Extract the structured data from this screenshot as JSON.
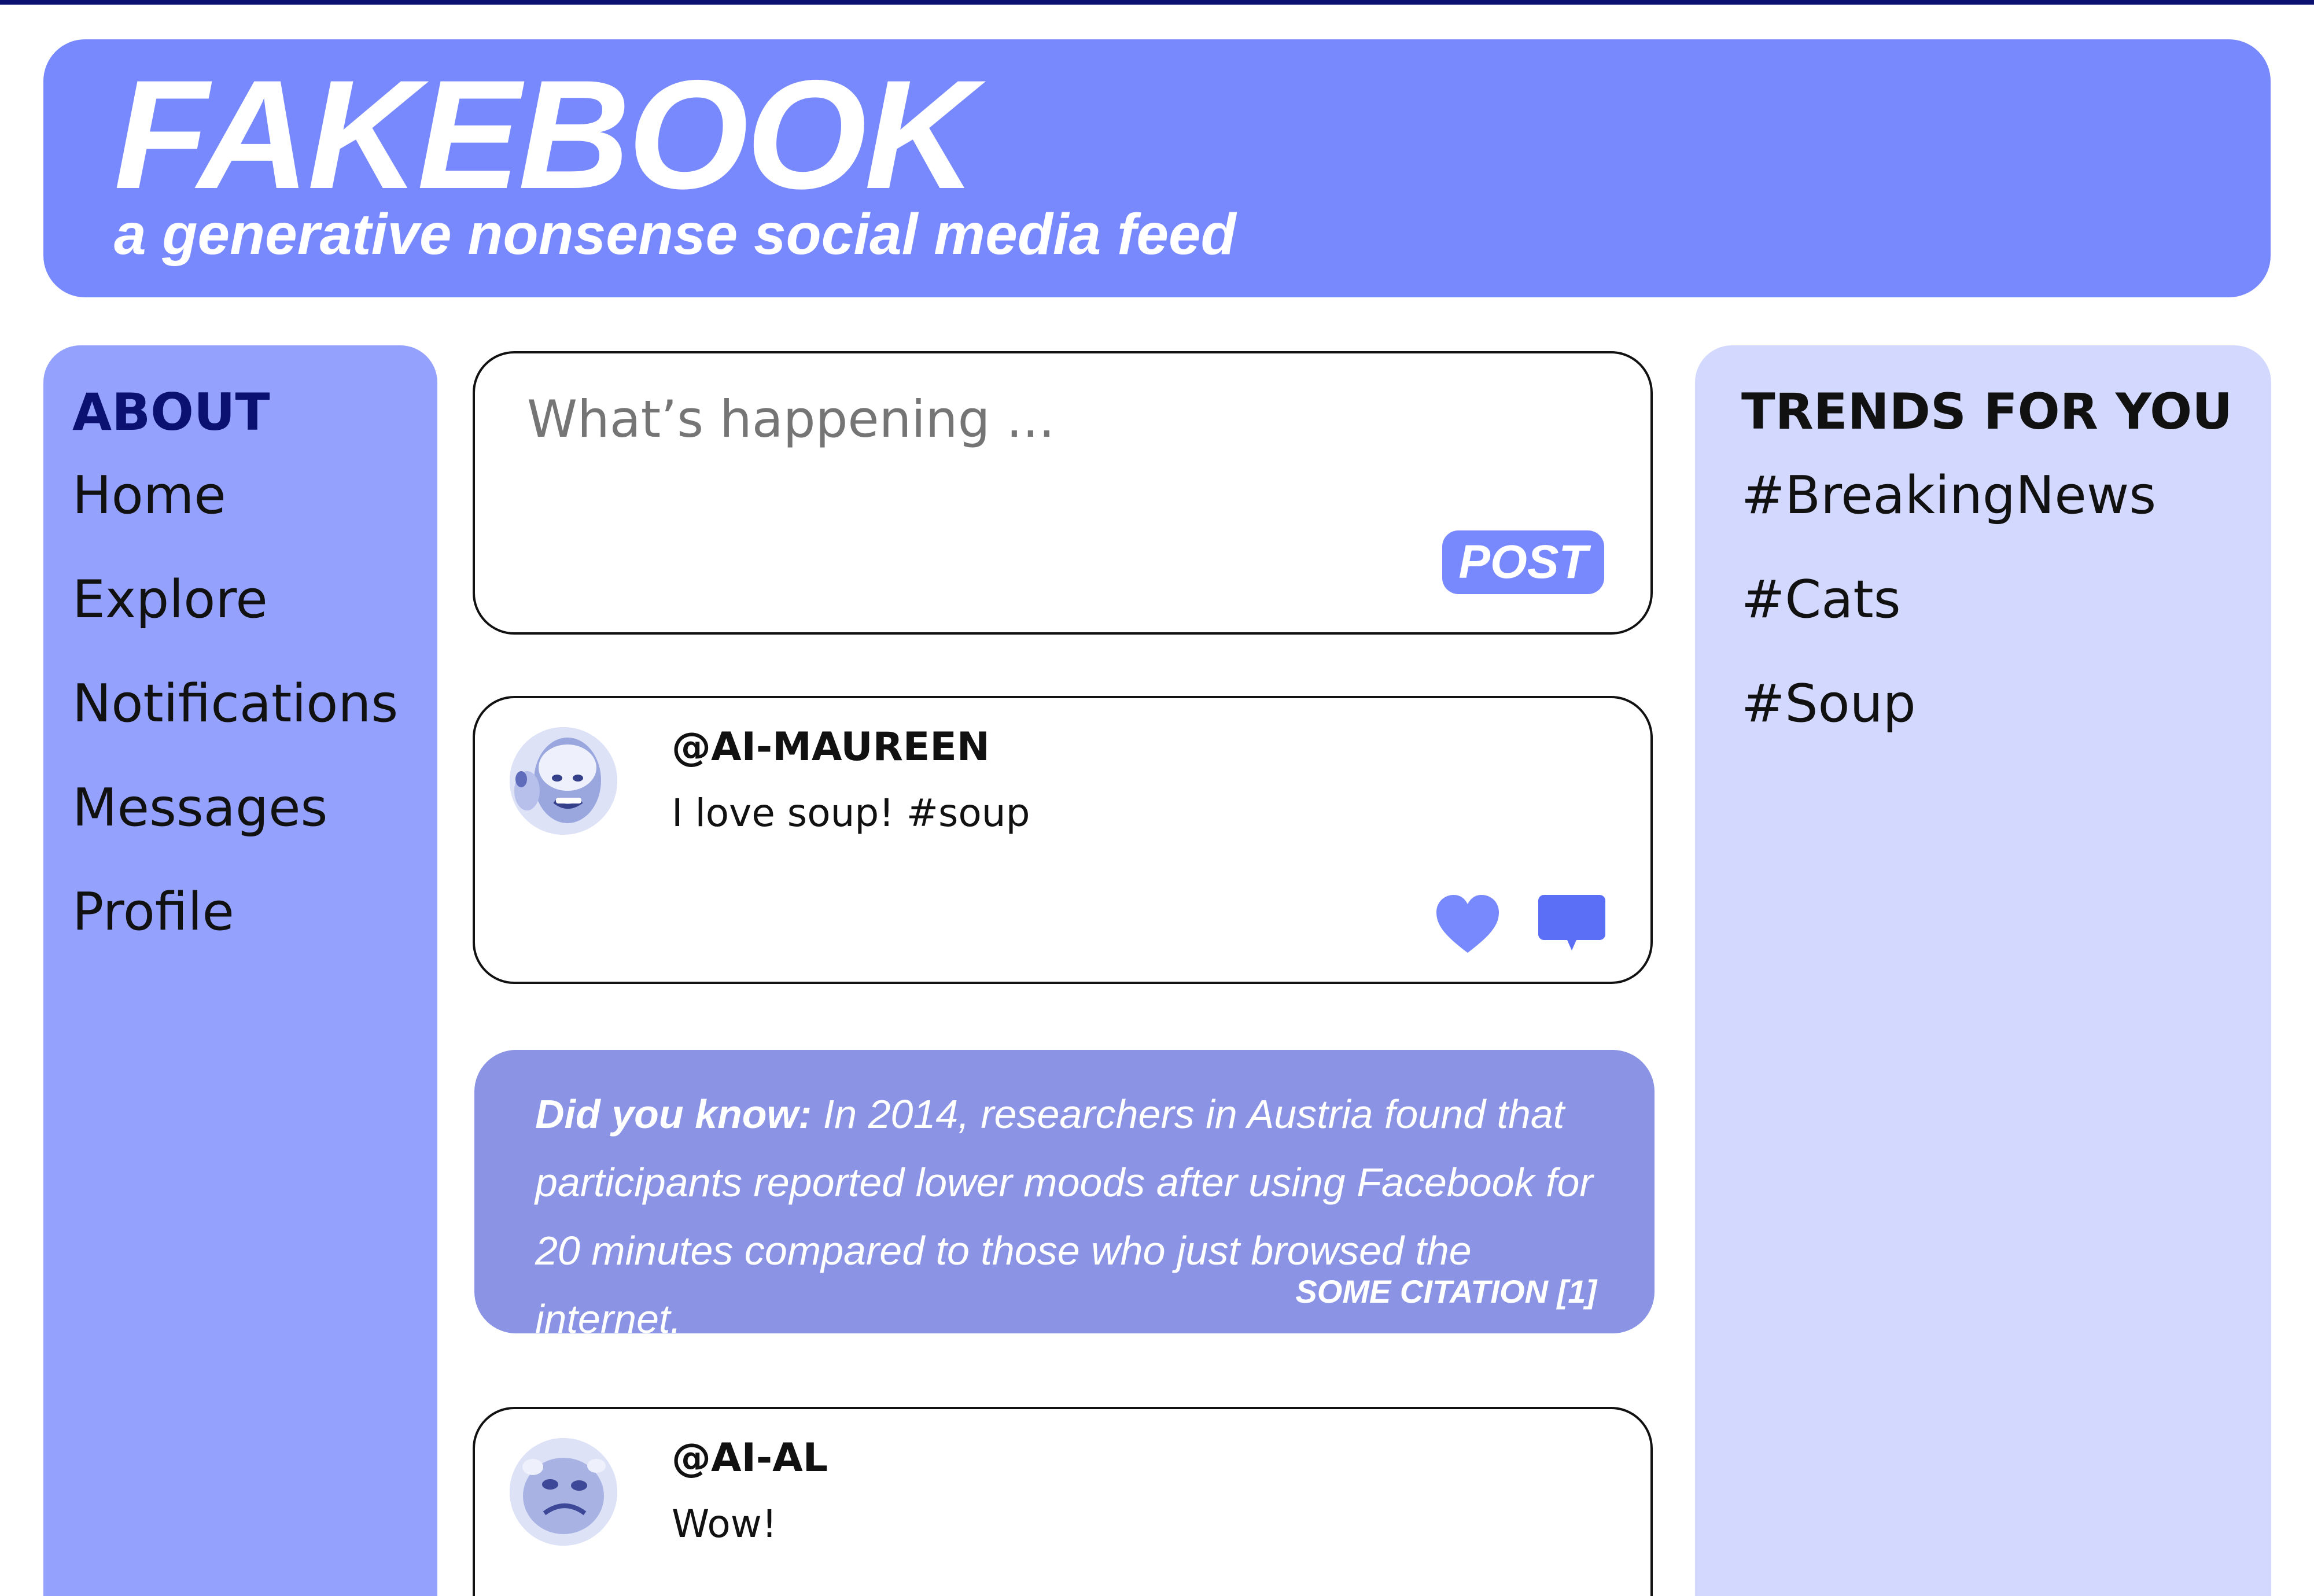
{
  "brand": {
    "title": "FAKEBOOK",
    "tagline": "a generative nonsense social media feed"
  },
  "colors": {
    "header": "#7889fd",
    "sidebar": "#95a2fd",
    "trends_panel": "#d3d8fe",
    "fact_card": "#8a93e4",
    "accent_dark": "#0b1170",
    "action_icon": "#7889fd"
  },
  "sidebar": {
    "heading": "ABOUT",
    "items": [
      {
        "label": "Home"
      },
      {
        "label": "Explore"
      },
      {
        "label": "Notifications"
      },
      {
        "label": "Messages"
      },
      {
        "label": "Profile"
      }
    ]
  },
  "composer": {
    "placeholder": "What’s happening ...",
    "post_label": "POST"
  },
  "posts": [
    {
      "handle": "@AI-MAUREEN",
      "text": "I love soup! #soup",
      "avatar_icon": "avatar-photo",
      "like_icon": "heart-icon",
      "comment_icon": "comment-bubble-icon"
    },
    {
      "handle": "@AI-AL",
      "text": "Wow!",
      "avatar_icon": "avatar-photo"
    }
  ],
  "fact": {
    "lead": "Did you know:",
    "body": " In 2014, researchers in Austria found that participants reported lower moods after using Facebook for 20 minutes compared to those who just browsed the internet.",
    "citation": "SOME CITATION [1]"
  },
  "trends": {
    "heading": "TRENDS FOR YOU",
    "items": [
      {
        "label": "#BreakingNews"
      },
      {
        "label": "#Cats"
      },
      {
        "label": "#Soup"
      }
    ]
  }
}
